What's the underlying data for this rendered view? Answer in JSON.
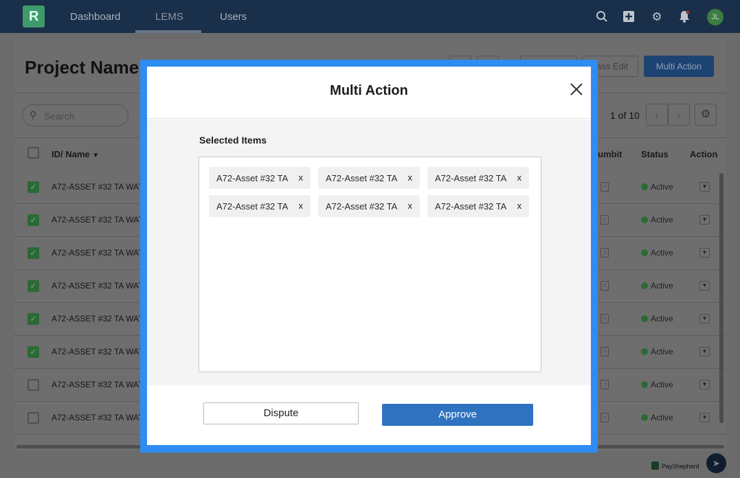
{
  "nav": {
    "logo_letter": "R",
    "links": [
      "Dashboard",
      "LEMS",
      "Users"
    ],
    "active": "LEMS",
    "icons": [
      "search-icon",
      "plus-square-icon",
      "gear-icon",
      "bell-icon"
    ],
    "avatar_initials": "JL"
  },
  "page": {
    "title": "Project Name",
    "buttons": {
      "mass_edit": "ass Edit",
      "multi_action": "Multi Action"
    },
    "search_placeholder": "Search",
    "pager": "1 of 10",
    "columns": [
      "ID/ Name",
      "umbit",
      "Status",
      "Action"
    ],
    "sort_indicator": "▼",
    "rows": [
      {
        "name": "A72-ASSET #32 TA WAT",
        "checked": true,
        "status": "Active"
      },
      {
        "name": "A72-ASSET #32 TA WAT",
        "checked": true,
        "status": "Active"
      },
      {
        "name": "A72-ASSET #32 TA WAT",
        "checked": true,
        "status": "Active"
      },
      {
        "name": "A72-ASSET #32 TA WAT",
        "checked": true,
        "status": "Active"
      },
      {
        "name": "A72-ASSET #32 TA WAT",
        "checked": true,
        "status": "Active"
      },
      {
        "name": "A72-ASSET #32 TA WAT",
        "checked": true,
        "status": "Active"
      },
      {
        "name": "A72-ASSET #32 TA WAT",
        "checked": false,
        "status": "Active"
      },
      {
        "name": "A72-ASSET #32 TA WAT",
        "checked": false,
        "status": "Active"
      }
    ],
    "brand": "PayShepherd"
  },
  "modal": {
    "title": "Multi Action",
    "selected_label": "Selected Items",
    "chips": [
      "A72-Asset #32 TA",
      "A72-Asset #32 TA",
      "A72-Asset #32 TA",
      "A72-Asset #32 TA",
      "A72-Asset #32 TA",
      "A72-Asset #32 TA"
    ],
    "chip_remove": "x",
    "dispute_label": "Dispute",
    "approve_label": "Approve"
  },
  "colors": {
    "modal_border": "#2f8cf2",
    "approve": "#2f72c0",
    "nav_bg": "#1a2f4a",
    "status_active": "#2b6a34"
  }
}
